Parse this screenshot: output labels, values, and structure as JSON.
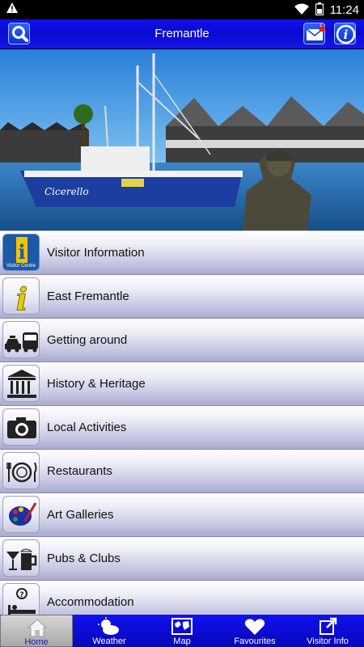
{
  "status_bar": {
    "time": "11:24",
    "warning_icon": "warning-icon",
    "battery_icon": "battery-icon",
    "wifi_icon": "wifi-icon"
  },
  "header": {
    "title": "Fremantle",
    "search_icon": "search-icon",
    "mail_icon": "mail-icon",
    "mail_badge": "1",
    "info_icon": "info-icon"
  },
  "hero": {
    "image": "harbour-photo-with-statue",
    "boat_name": "Cicerello"
  },
  "menu": {
    "items": [
      {
        "label": "Visitor Information",
        "icon": "visitor-centre-icon",
        "icon_caption": "Visitor Centre"
      },
      {
        "label": "East Fremantle",
        "icon": "info-i-icon"
      },
      {
        "label": "Getting around",
        "icon": "taxi-bus-icon"
      },
      {
        "label": "History & Heritage",
        "icon": "museum-icon"
      },
      {
        "label": "Local Activities",
        "icon": "camera-icon"
      },
      {
        "label": "Restaurants",
        "icon": "dining-icon"
      },
      {
        "label": "Art Galleries",
        "icon": "palette-icon"
      },
      {
        "label": "Pubs & Clubs",
        "icon": "drinks-icon"
      },
      {
        "label": "Accommodation",
        "icon": "bed-icon"
      }
    ]
  },
  "tabbar": {
    "tabs": [
      {
        "label": "Home",
        "icon": "home-icon",
        "active": true
      },
      {
        "label": "Weather",
        "icon": "weather-icon",
        "active": false
      },
      {
        "label": "Map",
        "icon": "map-icon",
        "active": false
      },
      {
        "label": "Favourites",
        "icon": "heart-icon",
        "active": false
      },
      {
        "label": "Visitor Info",
        "icon": "external-link-icon",
        "active": false
      }
    ]
  },
  "colors": {
    "header_blue": "#0a0ad0",
    "tab_blue": "#0707b8",
    "menu_gradient_bottom": "#a9abcf"
  }
}
